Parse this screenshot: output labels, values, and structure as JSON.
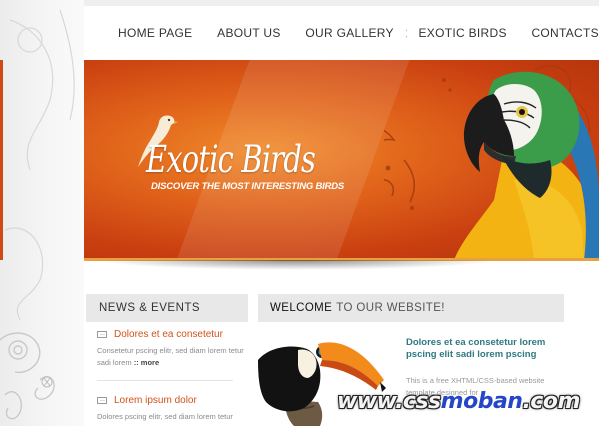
{
  "nav": {
    "items": [
      "HOME PAGE",
      "ABOUT US",
      "OUR GALLERY",
      "EXOTIC BIRDS",
      "CONTACTS"
    ]
  },
  "banner": {
    "title": "Exotic Birds",
    "tagline": "DISCOVER THE MOST INTERESTING BIRDS"
  },
  "news": {
    "heading": "NEWS & EVENTS",
    "items": [
      {
        "title": "Dolores et ea consetetur",
        "text": "Consetetur pscing elitr, sed diam lorem tetur sadi lorem",
        "more": ":: more"
      },
      {
        "title": "Lorem ipsum dolor",
        "text": "Dolores pscing elitr, sed diam lorem tetur",
        "more": ""
      }
    ]
  },
  "welcome": {
    "heading_bold": "WELCOME",
    "heading_rest": "TO OUR WEBSITE!",
    "title": "Dolores et ea consetetur lorem pscing elit sadi lorem pscing",
    "text": "This is a free XHTML/CSS-based website template designed for"
  },
  "watermark": {
    "part1": "www.css",
    "part2": "moban",
    "part3": ".com"
  },
  "colors": {
    "accent": "#d2531a",
    "teal": "#2f7a80",
    "banner": "#e0621a"
  }
}
